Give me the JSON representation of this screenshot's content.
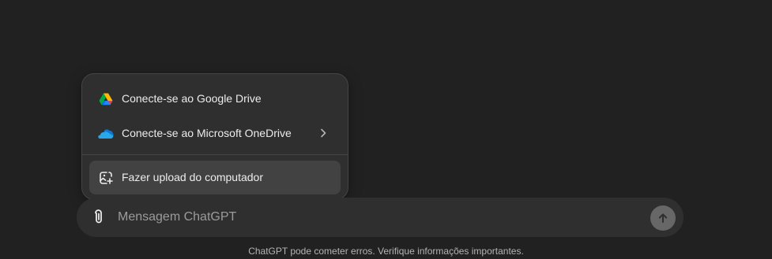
{
  "attach_menu": {
    "items": [
      {
        "label": "Conecte-se ao Google Drive",
        "icon": "google-drive-icon"
      },
      {
        "label": "Conecte-se ao Microsoft OneDrive",
        "icon": "onedrive-icon",
        "has_submenu": true
      },
      {
        "label": "Fazer upload do computador",
        "icon": "upload-computer-icon",
        "highlighted": true
      }
    ]
  },
  "composer": {
    "placeholder": "Mensagem ChatGPT",
    "value": "",
    "attach_icon": "paperclip-icon",
    "send_icon": "arrow-up-icon"
  },
  "footer": {
    "disclaimer": "ChatGPT pode cometer erros. Verifique informações importantes."
  },
  "colors": {
    "background": "#212121",
    "surface": "#2f2f2f",
    "highlight": "#424242",
    "send_button": "#676767"
  }
}
